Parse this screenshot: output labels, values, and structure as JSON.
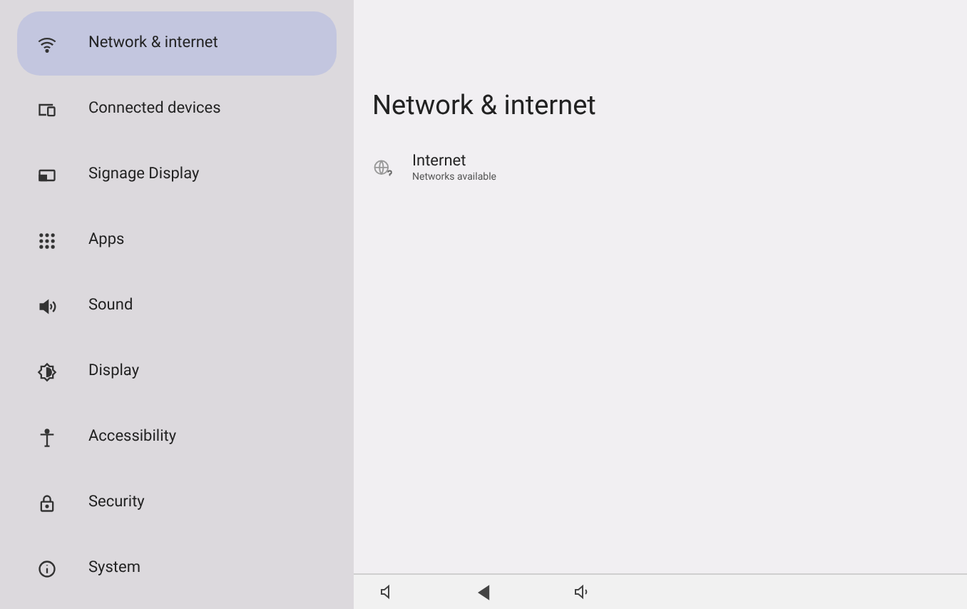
{
  "sidebar": {
    "items": [
      {
        "label": "Network & internet",
        "kind": "wifi",
        "selected": true
      },
      {
        "label": "Connected devices",
        "kind": "devices",
        "selected": false
      },
      {
        "label": "Signage Display",
        "kind": "display",
        "selected": false
      },
      {
        "label": "Apps",
        "kind": "apps",
        "selected": false
      },
      {
        "label": "Sound",
        "kind": "sound",
        "selected": false
      },
      {
        "label": "Display",
        "kind": "brightness",
        "selected": false
      },
      {
        "label": "Accessibility",
        "kind": "accessibility",
        "selected": false
      },
      {
        "label": "Security",
        "kind": "lock",
        "selected": false
      },
      {
        "label": "System",
        "kind": "system",
        "selected": false
      }
    ]
  },
  "page": {
    "title": "Network & internet",
    "items": [
      {
        "title": "Internet",
        "subtitle": "Networks available"
      }
    ]
  }
}
